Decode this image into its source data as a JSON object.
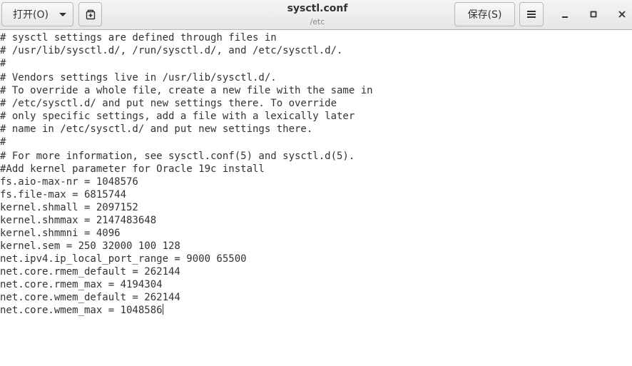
{
  "header": {
    "open_label": "打开(O)",
    "save_label": "保存(S)",
    "title": "sysctl.conf",
    "subtitle": "/etc"
  },
  "icons": {
    "open_dropdown": "chevron-down-icon",
    "new_tab": "new-document-icon",
    "menu": "hamburger-menu-icon",
    "minimize": "minimize-icon",
    "maximize": "maximize-icon",
    "close": "close-icon"
  },
  "editor": {
    "lines": [
      "# sysctl settings are defined through files in",
      "# /usr/lib/sysctl.d/, /run/sysctl.d/, and /etc/sysctl.d/.",
      "#",
      "# Vendors settings live in /usr/lib/sysctl.d/.",
      "# To override a whole file, create a new file with the same in",
      "# /etc/sysctl.d/ and put new settings there. To override",
      "# only specific settings, add a file with a lexically later",
      "# name in /etc/sysctl.d/ and put new settings there.",
      "#",
      "# For more information, see sysctl.conf(5) and sysctl.d(5).",
      "#Add kernel parameter for Oracle 19c install",
      "fs.aio-max-nr = 1048576",
      "fs.file-max = 6815744",
      "kernel.shmall = 2097152",
      "kernel.shmmax = 2147483648",
      "kernel.shmmni = 4096",
      "kernel.sem = 250 32000 100 128",
      "net.ipv4.ip_local_port_range = 9000 65500",
      "net.core.rmem_default = 262144",
      "net.core.rmem_max = 4194304",
      "net.core.wmem_default = 262144",
      "net.core.wmem_max = 1048586"
    ]
  }
}
